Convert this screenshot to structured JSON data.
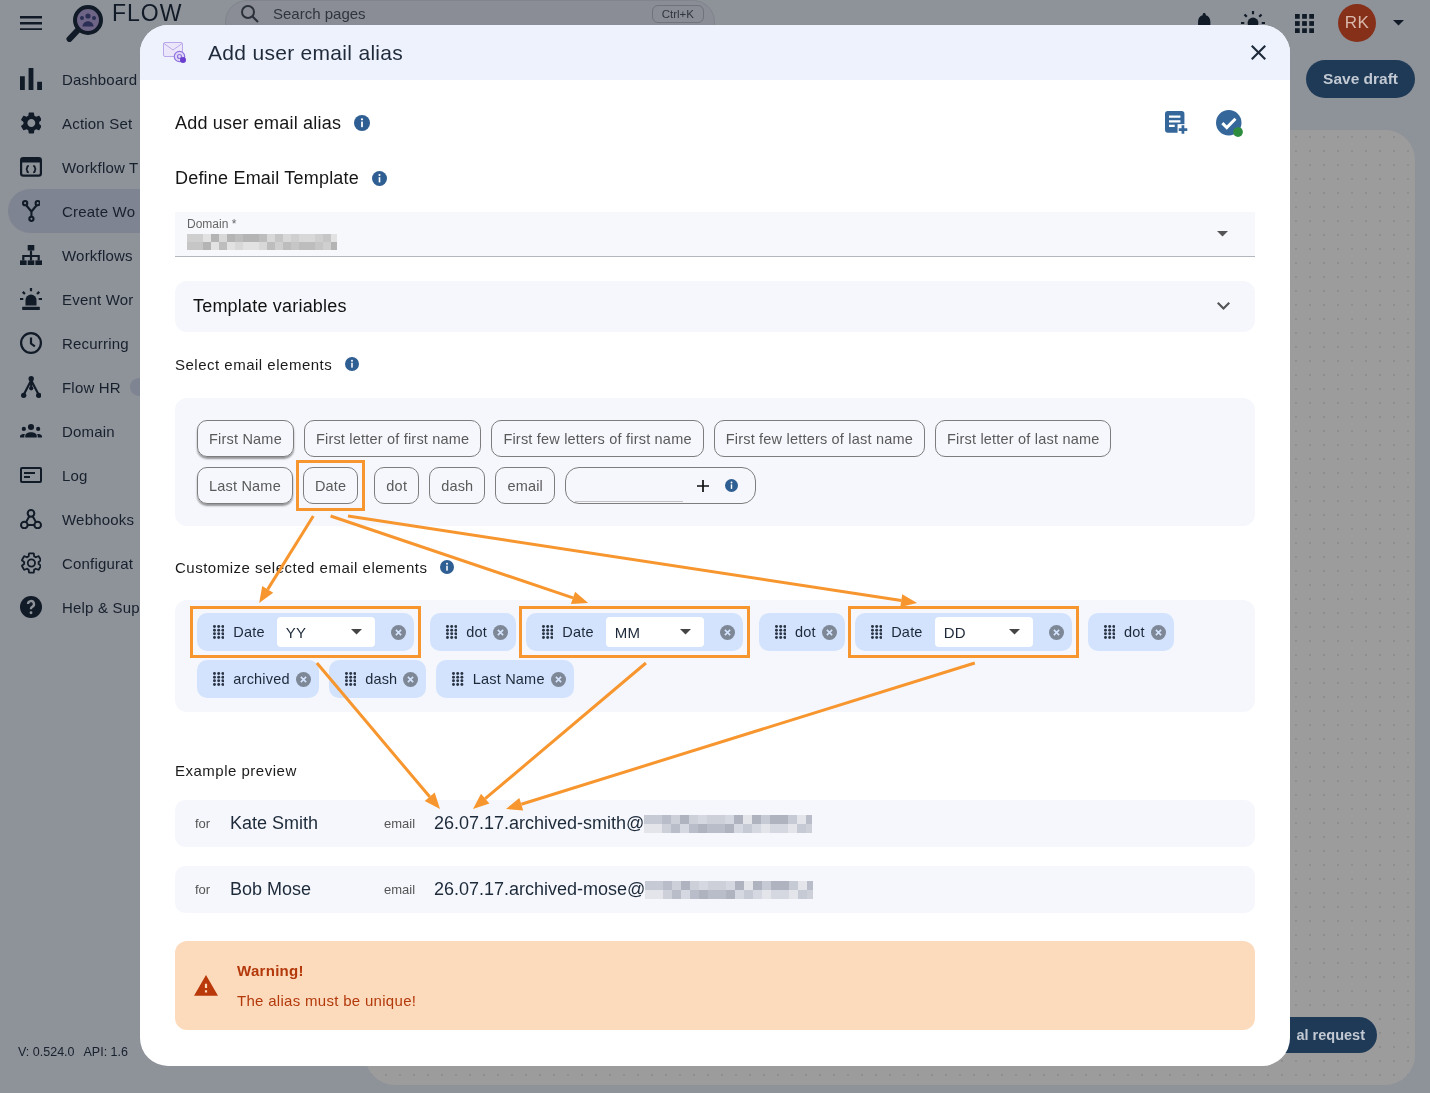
{
  "app_header": {
    "logo_text": "FLOW",
    "search": {
      "placeholder": "Search pages",
      "shortcut": "Ctrl+K"
    },
    "avatar": {
      "initials": "RK"
    }
  },
  "sidebar": {
    "items": [
      {
        "label": "Dashboard",
        "selected": false,
        "badge": false
      },
      {
        "label": "Action Set",
        "selected": false,
        "badge": false
      },
      {
        "label": "Workflow T",
        "selected": false,
        "badge": false
      },
      {
        "label": "Create Wo",
        "selected": true,
        "badge": false
      },
      {
        "label": "Workflows",
        "selected": false,
        "badge": false
      },
      {
        "label": "Event Wor",
        "selected": false,
        "badge": false
      },
      {
        "label": "Recurring",
        "selected": false,
        "badge": false
      },
      {
        "label": "Flow HR",
        "selected": false,
        "badge": true
      },
      {
        "label": "Domain",
        "selected": false,
        "badge": false
      },
      {
        "label": "Log",
        "selected": false,
        "badge": false
      },
      {
        "label": "Webhooks",
        "selected": false,
        "badge": false
      },
      {
        "label": "Configurat",
        "selected": false,
        "badge": false
      },
      {
        "label": "Help & Sup",
        "selected": false,
        "badge": false
      }
    ],
    "version": "V: 0.524.0",
    "api": "API: 1.6"
  },
  "toolbar": {
    "save_draft": "Save draft",
    "request_button": "al request"
  },
  "dialog": {
    "title": "Add user email alias",
    "heading": "Add user email alias",
    "template_title": "Define Email Template",
    "domain_field": {
      "label": "Domain *"
    },
    "template_variables": {
      "label": "Template variables",
      "expanded": false
    },
    "element_picker": {
      "label": "Select email elements",
      "elements": [
        {
          "label": "First Name",
          "raised": true,
          "highlighted": false
        },
        {
          "label": "First letter of first name",
          "raised": false,
          "highlighted": false
        },
        {
          "label": "First few letters of first name",
          "raised": false,
          "highlighted": false
        },
        {
          "label": "First few letters of last name",
          "raised": false,
          "highlighted": false
        },
        {
          "label": "First letter of last name",
          "raised": false,
          "highlighted": false
        },
        {
          "label": "Last Name",
          "raised": true,
          "highlighted": false
        },
        {
          "label": "Date",
          "raised": false,
          "highlighted": true
        },
        {
          "label": "dot",
          "raised": false,
          "highlighted": false
        },
        {
          "label": "dash",
          "raised": false,
          "highlighted": false
        },
        {
          "label": "email",
          "raised": false,
          "highlighted": false
        }
      ]
    },
    "selected_elements": {
      "label": "Customize selected email elements",
      "items": [
        {
          "kind": "date",
          "label": "Date",
          "format": "YY",
          "highlighted": true
        },
        {
          "kind": "text",
          "label": "dot",
          "highlighted": false
        },
        {
          "kind": "date",
          "label": "Date",
          "format": "MM",
          "highlighted": true
        },
        {
          "kind": "text",
          "label": "dot",
          "highlighted": false
        },
        {
          "kind": "date",
          "label": "Date",
          "format": "DD",
          "highlighted": true
        },
        {
          "kind": "text",
          "label": "dot",
          "highlighted": false
        },
        {
          "kind": "text",
          "label": "archived",
          "highlighted": false
        },
        {
          "kind": "text",
          "label": "dash",
          "highlighted": false
        },
        {
          "kind": "text",
          "label": "Last Name",
          "highlighted": false
        }
      ]
    },
    "preview": {
      "label": "Example preview",
      "rows": [
        {
          "for_label": "for",
          "name": "Kate Smith",
          "email_label": "email",
          "email": "26.07.17.archived-smith@"
        },
        {
          "for_label": "for",
          "name": "Bob Mose",
          "email_label": "email",
          "email": "26.07.17.archived-mose@"
        }
      ]
    },
    "warning": {
      "title": "Warning!",
      "message": "The alias must be unique!"
    }
  },
  "annotations": {
    "arrows": true
  }
}
